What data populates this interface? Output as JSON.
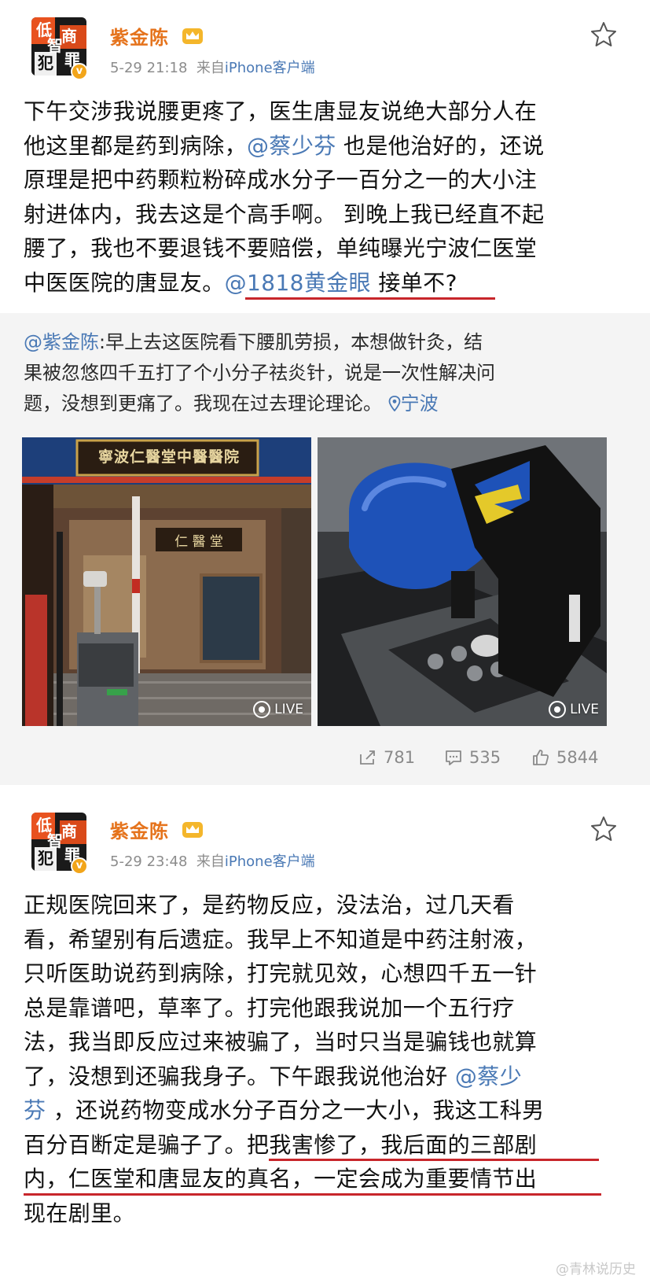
{
  "post1": {
    "username": "紫金陈",
    "time": "5-29 21:18",
    "via": "来自",
    "source": "iPhone客户端",
    "lines": [
      [
        {
          "t": "下午交涉我说腰更疼了，医生唐显友说绝大部分人在"
        }
      ],
      [
        {
          "t": "他这里都是药到病除，"
        },
        {
          "t": "@蔡少芬",
          "at": true
        },
        {
          "t": " 也是他治好的，还说"
        }
      ],
      [
        {
          "t": "原理是把中药颗粒粉碎成水分子一百分之一的大小注"
        }
      ],
      [
        {
          "t": "射进体内，我去这是个高手啊。 到晚上我已经直不起"
        }
      ],
      [
        {
          "t": "腰了，我也不要退钱不要赔偿，单纯曝光宁波仁医堂"
        }
      ],
      [
        {
          "t": "中医医院的唐显友。"
        },
        {
          "t": "@1818黄金眼",
          "at": true
        },
        {
          "t": " 接单不?"
        }
      ]
    ],
    "repost": {
      "author": "@紫金陈",
      "text_l1": ":早上去这医院看下腰肌劳损，本想做针灸，结",
      "text_l2": "果被忽悠四千五打了个小分子祛炎针，说是一次性解决问",
      "text_l3": "题，没想到更痛了。我现在过去理论理论。",
      "location": "宁波",
      "photo_left_sign": "寧波仁醫堂中醫醫院",
      "photo_left_door": "仁 醫 堂",
      "live_label": "LIVE"
    },
    "reposts": "781",
    "comments": "535",
    "likes": "5844"
  },
  "post2": {
    "username": "紫金陈",
    "time": "5-29 23:48",
    "via": "来自",
    "source": "iPhone客户端",
    "lines": [
      [
        {
          "t": "正规医院回来了，是药物反应，没法治，过几天看"
        }
      ],
      [
        {
          "t": "看，希望别有后遗症。我早上不知道是中药注射液，"
        }
      ],
      [
        {
          "t": "只听医助说药到病除，打完就见效，心想四千五一针"
        }
      ],
      [
        {
          "t": "总是靠谱吧，草率了。打完他跟我说加一个五行疗"
        }
      ],
      [
        {
          "t": "法，我当即反应过来被骗了，当时只当是骗钱也就算"
        }
      ],
      [
        {
          "t": "了，没想到还骗我身子。下午跟我说他治好 "
        },
        {
          "t": "@蔡少",
          "at": true
        }
      ],
      [
        {
          "t": "芬",
          "at": true
        },
        {
          "t": " ，还说药物变成水分子百分之一大小，我这工科男"
        }
      ],
      [
        {
          "t": "百分百断定是骗子了。把我害惨了，我后面的三部剧"
        }
      ],
      [
        {
          "t": "内，仁医堂和唐显友的真名，一定会成为重要情节出"
        }
      ],
      [
        {
          "t": "现在剧里。"
        }
      ]
    ],
    "avatar_chars": [
      "低",
      "智",
      "商",
      "犯",
      "罪"
    ]
  },
  "watermark": "@青林说历史"
}
